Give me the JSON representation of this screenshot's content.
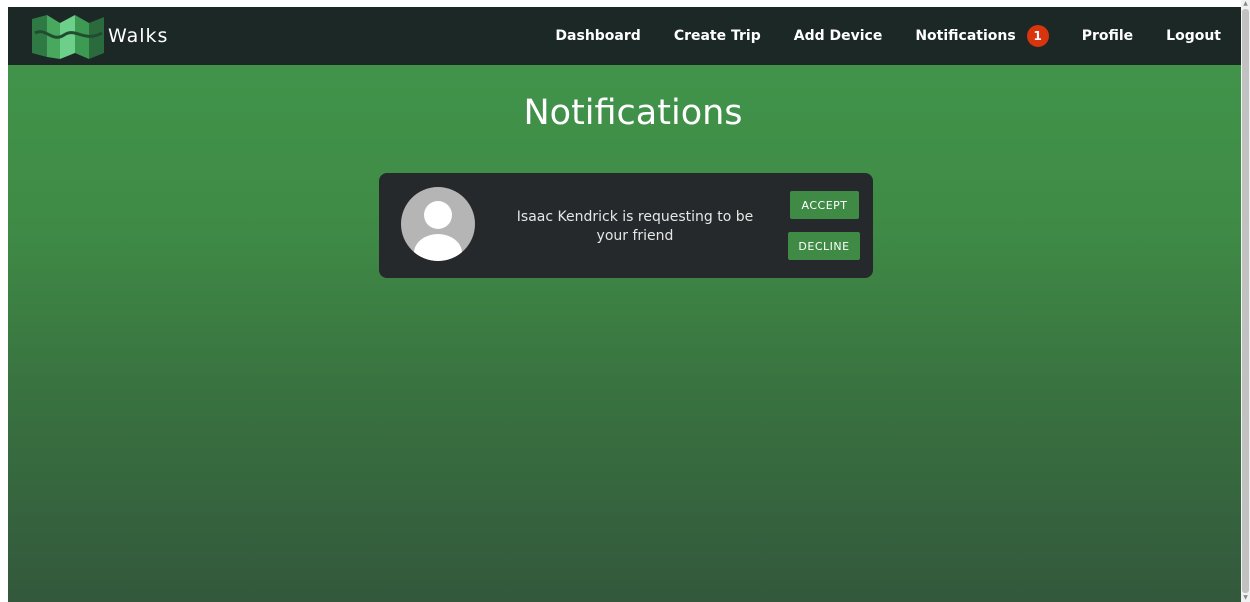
{
  "brand": {
    "name": "Walks",
    "logo_icon": "folded-map-logo-icon"
  },
  "nav": {
    "items": [
      {
        "label": "Dashboard"
      },
      {
        "label": "Create Trip"
      },
      {
        "label": "Add Device"
      },
      {
        "label": "Notifications",
        "badge": "1"
      },
      {
        "label": "Profile"
      },
      {
        "label": "Logout"
      }
    ]
  },
  "page": {
    "title": "Notifications"
  },
  "notifications": [
    {
      "avatar_icon": "default-user-avatar-icon",
      "message": "Isaac Kendrick is requesting to be your friend",
      "accept_label": "ACCEPT",
      "decline_label": "DECLINE"
    }
  ],
  "colors": {
    "navbar": "#1c2826",
    "accent_green": "#3f8b46",
    "badge": "#d8340e",
    "card": "#25292b"
  }
}
